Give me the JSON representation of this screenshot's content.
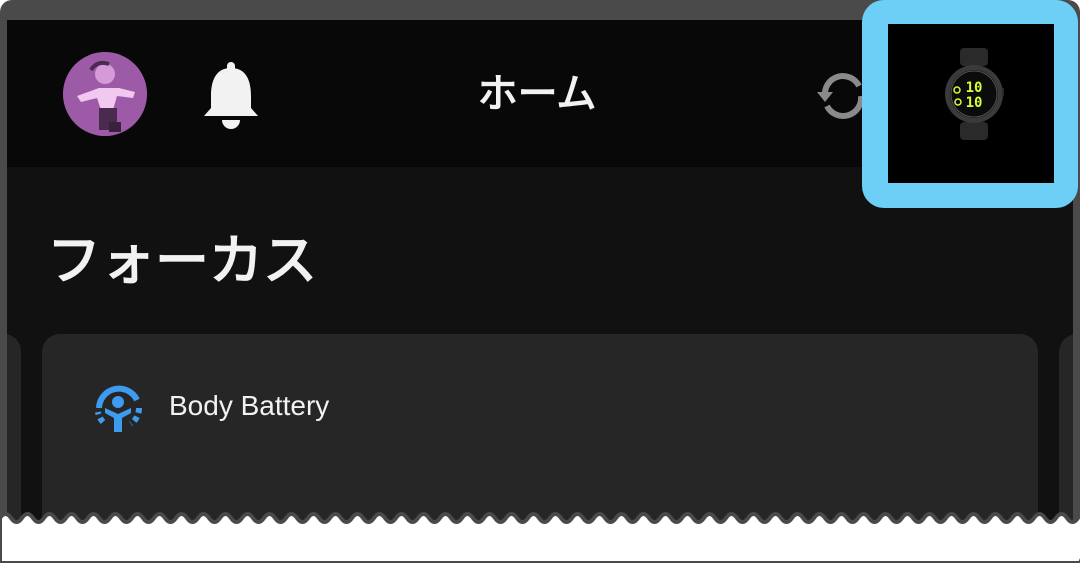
{
  "header": {
    "title": "ホーム",
    "avatar_icon": "avatar-yoga-figure",
    "bell_icon": "bell-icon",
    "sync_icon": "sync-icon",
    "device_icon": "watch-icon"
  },
  "focus": {
    "section_title": "フォーカス",
    "card": {
      "icon": "body-battery-icon",
      "label": "Body Battery"
    }
  },
  "colors": {
    "highlight": "#6dcff6",
    "accent_blue": "#3d9bf0",
    "watch_accent": "#d4ff3a",
    "avatar_bg": "#9d5aa6"
  }
}
